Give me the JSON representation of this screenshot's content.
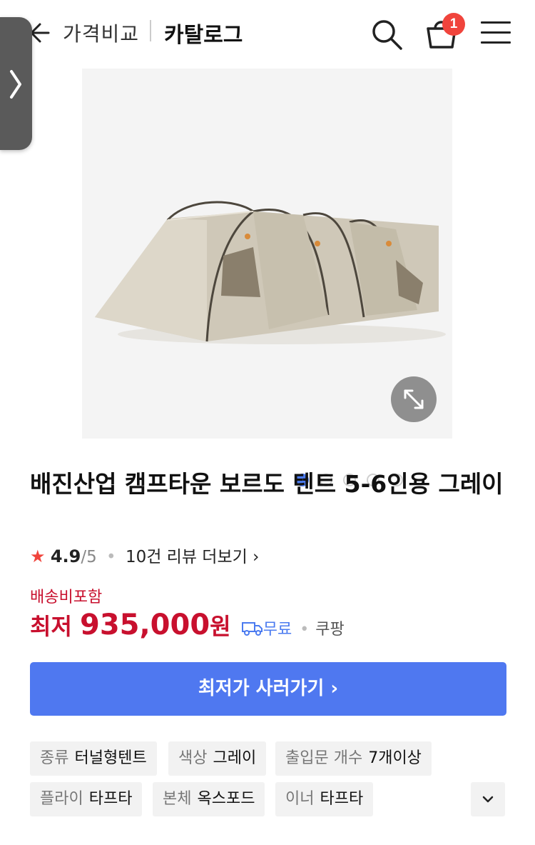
{
  "header": {
    "breadcrumb_1": "가격비교",
    "breadcrumb_2": "카탈로그",
    "cart_count": "1",
    "icons": [
      "back-arrow-icon",
      "search-icon",
      "cart-icon",
      "menu-icon"
    ]
  },
  "gallery": {
    "image_count": 5,
    "active_index": 0
  },
  "product": {
    "title": "배진산업 캠프타운 보르도 텐트 5-6인용 그레이",
    "rating_score": "4.9",
    "rating_total": "/5",
    "review_link": "10건 리뷰 더보기",
    "shipping_note": "배송비포함",
    "price_label": "최저",
    "price_value": "935,000",
    "price_unit": "원",
    "shipping": "무료",
    "seller": "쿠팡"
  },
  "buy_button": {
    "label": "최저가 사러가기"
  },
  "specs": [
    {
      "key": "종류",
      "value": "터널형텐트"
    },
    {
      "key": "색상",
      "value": "그레이"
    },
    {
      "key": "출입문 개수",
      "value": "7개이상"
    },
    {
      "key": "플라이",
      "value": "타프타"
    },
    {
      "key": "본체",
      "value": "옥스포드"
    },
    {
      "key": "이너",
      "value": "타프타"
    }
  ],
  "colors": {
    "accent_blue": "#4f78f0",
    "price_red": "#c8102e",
    "badge_red": "#f0443c"
  }
}
